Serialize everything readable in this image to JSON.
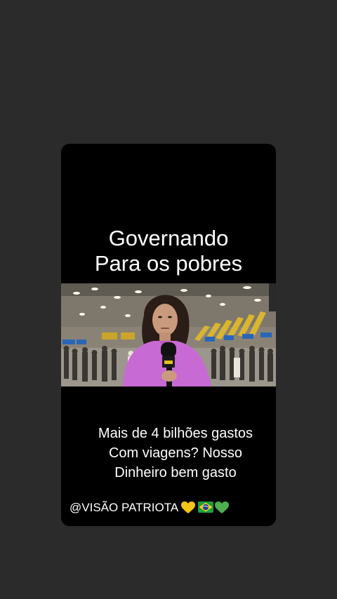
{
  "post": {
    "title_lines": [
      "Governando",
      "Para os pobres"
    ],
    "caption_lines": [
      "Mais de 4 bilhões gastos",
      "Com viagens? Nosso",
      "Dinheiro bem gasto"
    ],
    "watermark": "@VISÃO PATRIOTA",
    "watermark_icons": [
      "yellow-heart-icon",
      "brazil-flag-icon",
      "green-heart-icon"
    ]
  },
  "colors": {
    "page_background": "#2b2b2b",
    "card_background": "#000000",
    "text": "#ffffff",
    "yellow_heart": "#f5c518",
    "green_heart": "#4caf50",
    "reporter_blouse": "#c86ad4"
  }
}
